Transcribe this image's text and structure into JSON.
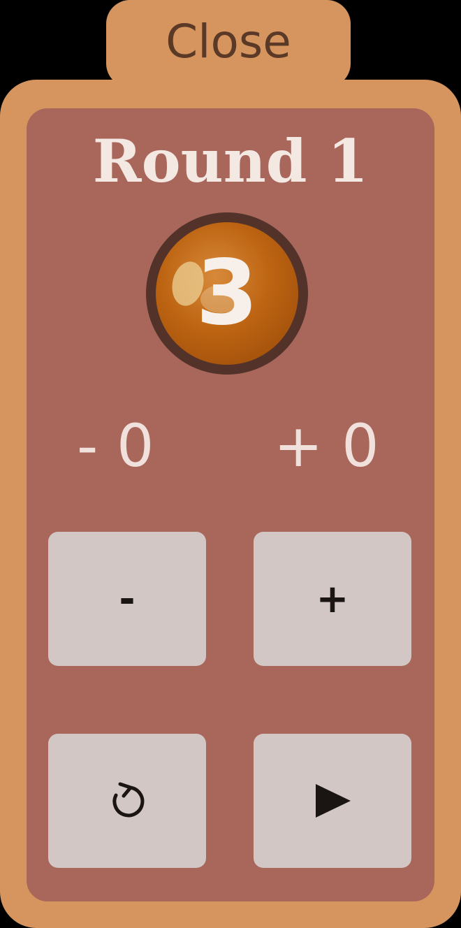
{
  "close_tab": {
    "label": "Close"
  },
  "round": {
    "title": "Round 1"
  },
  "counter": {
    "value": "3"
  },
  "deltas": {
    "minus": "- 0",
    "plus": "+ 0"
  },
  "buttons": {
    "decrement_label": "-",
    "increment_label": "+",
    "reset_icon": "reset-icon",
    "play_icon": "play-icon"
  },
  "colors": {
    "frame": "#d6955e",
    "panel": "#a9665b",
    "counter": "#bd6412",
    "button": "#d2c7c5"
  }
}
